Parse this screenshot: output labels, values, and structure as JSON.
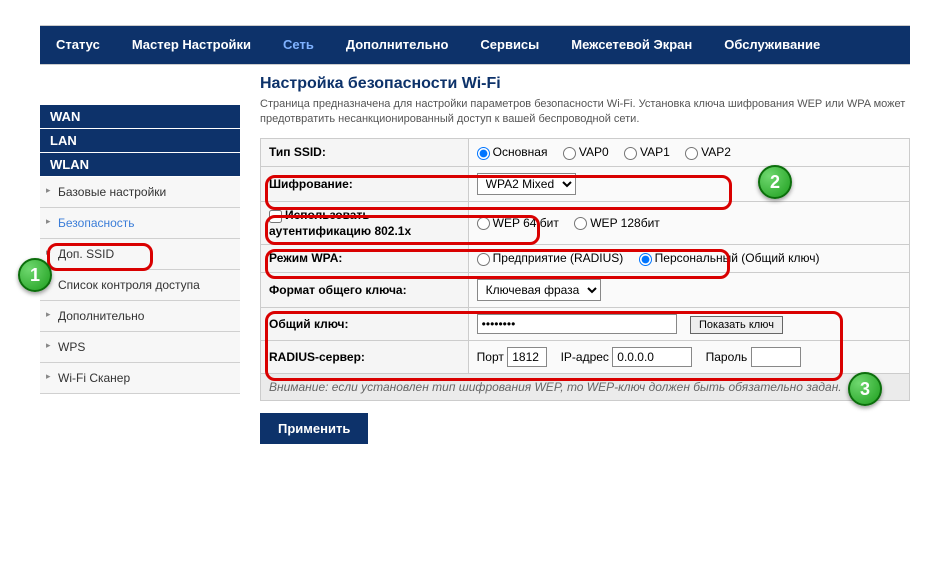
{
  "topnav": {
    "status": "Статус",
    "wizard": "Мастер Настройки",
    "network": "Сеть",
    "advanced": "Дополнительно",
    "services": "Сервисы",
    "firewall": "Межсетевой Экран",
    "maintenance": "Обслуживание"
  },
  "sidebar": {
    "groups": {
      "wan": "WAN",
      "lan": "LAN",
      "wlan": "WLAN"
    },
    "items": {
      "basic": "Базовые настройки",
      "security": "Безопасность",
      "addssid": "Доп. SSID",
      "acl": "Список контроля доступа",
      "adv": "Дополнительно",
      "wps": "WPS",
      "scanner": "Wi-Fi Сканер"
    }
  },
  "page": {
    "title": "Настройка безопасности Wi-Fi",
    "desc": "Страница предназначена для настройки параметров безопасности Wi-Fi. Установка ключа шифрования WEP или WPA может предотвратить несанкционированный доступ к вашей беспроводной сети."
  },
  "form": {
    "ssid_type_label": "Тип SSID:",
    "ssid_main": "Основная",
    "ssid_vap0": "VAP0",
    "ssid_vap1": "VAP1",
    "ssid_vap2": "VAP2",
    "encryption_label": "Шифрование:",
    "encryption_value": "WPA2 Mixed",
    "auth8021x": "Использовать аутентификацию 802.1x",
    "wep64": "WEP 64 бит",
    "wep128": "WEP 128бит",
    "wpa_mode_label": "Режим WPA:",
    "wpa_enterprise": "Предприятие (RADIUS)",
    "wpa_personal": "Персональный (Общий ключ)",
    "psk_format_label": "Формат общего ключа:",
    "psk_format_value": "Ключевая фраза",
    "psk_label": "Общий ключ:",
    "psk_value": "••••••••",
    "show_key": "Показать ключ",
    "radius_label": "RADIUS-сервер:",
    "radius_port_label": "Порт",
    "radius_port": "1812",
    "radius_ip_label": "IP-адрес",
    "radius_ip": "0.0.0.0",
    "radius_pwd_label": "Пароль",
    "note": "Внимание: если установлен тип шифрования WEP, то WEP-ключ должен быть обязательно задан."
  },
  "apply": "Применить",
  "badges": {
    "one": "1",
    "two": "2",
    "three": "3"
  }
}
